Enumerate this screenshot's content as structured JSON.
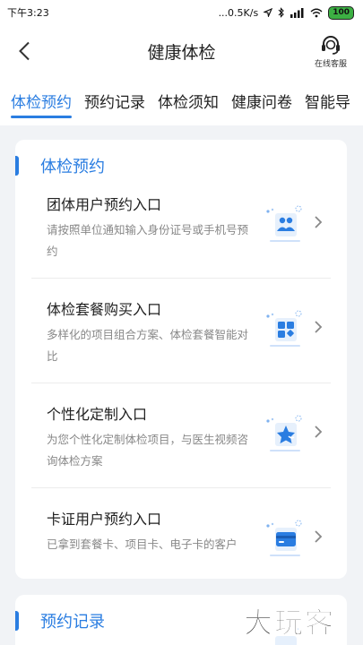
{
  "status_bar": {
    "time": "下午3:23",
    "network_speed": "...0.5K/s",
    "battery": "100"
  },
  "nav": {
    "title": "健康体检",
    "service_label": "在线客服"
  },
  "tabs": [
    {
      "label": "体检预约",
      "active": true
    },
    {
      "label": "预约记录",
      "active": false
    },
    {
      "label": "体检须知",
      "active": false
    },
    {
      "label": "健康问卷",
      "active": false
    },
    {
      "label": "智能导",
      "active": false
    }
  ],
  "sections": [
    {
      "title": "体检预约",
      "items": [
        {
          "title": "团体用户预约入口",
          "desc": "请按照单位通知输入身份证号或手机号预约",
          "icon": "group-users-icon"
        },
        {
          "title": "体检套餐购买入口",
          "desc": "多样化的项目组合方案、体检套餐智能对比",
          "icon": "package-grid-icon"
        },
        {
          "title": "个性化定制入口",
          "desc": "为您个性化定制体检项目，与医生视频咨询体检方案",
          "icon": "custom-star-icon"
        },
        {
          "title": "卡证用户预约入口",
          "desc": "已拿到套餐卡、项目卡、电子卡的客户",
          "icon": "card-icon"
        }
      ]
    },
    {
      "title": "预约记录"
    }
  ],
  "watermark": "大玩客",
  "colors": {
    "accent": "#2a7de1",
    "background": "#f1f3f6"
  }
}
